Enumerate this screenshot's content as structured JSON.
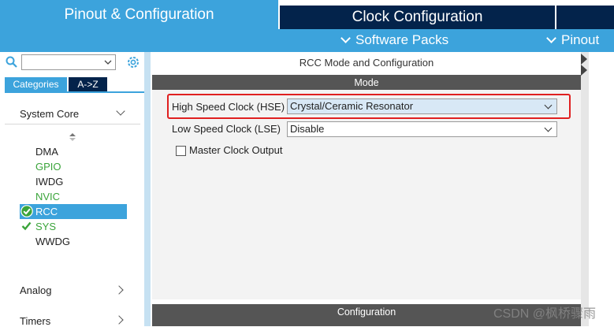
{
  "top_tabs": {
    "pinout_config": "Pinout & Configuration",
    "clock_config": "Clock Configuration"
  },
  "subbar": {
    "software_packs": "Software Packs",
    "pinout": "Pinout"
  },
  "sidebar": {
    "search_value": "",
    "tab_categories": "Categories",
    "tab_az": "A->Z",
    "categories": [
      {
        "label": "System Core"
      },
      {
        "label": "Analog"
      },
      {
        "label": "Timers"
      }
    ],
    "peripherals": [
      {
        "label": "DMA",
        "state": "normal"
      },
      {
        "label": "GPIO",
        "state": "configured"
      },
      {
        "label": "IWDG",
        "state": "normal"
      },
      {
        "label": "NVIC",
        "state": "configured"
      },
      {
        "label": "RCC",
        "state": "selected"
      },
      {
        "label": "SYS",
        "state": "configured"
      },
      {
        "label": "WWDG",
        "state": "normal"
      }
    ]
  },
  "main": {
    "title": "RCC Mode and Configuration",
    "mode_header": "Mode",
    "hse_label": "High Speed Clock (HSE)",
    "hse_value": "Crystal/Ceramic Resonator",
    "lse_label": "Low Speed Clock (LSE)",
    "lse_value": "Disable",
    "mco_label": "Master Clock Output",
    "mco_checked": false,
    "config_header": "Configuration"
  },
  "watermark": "CSDN @枫桥骤雨",
  "colors": {
    "accent": "#3ca3dc",
    "dark_navy": "#03234b",
    "header_gray": "#555555",
    "configured_green": "#3aa43a",
    "highlight_red": "#e02020"
  }
}
